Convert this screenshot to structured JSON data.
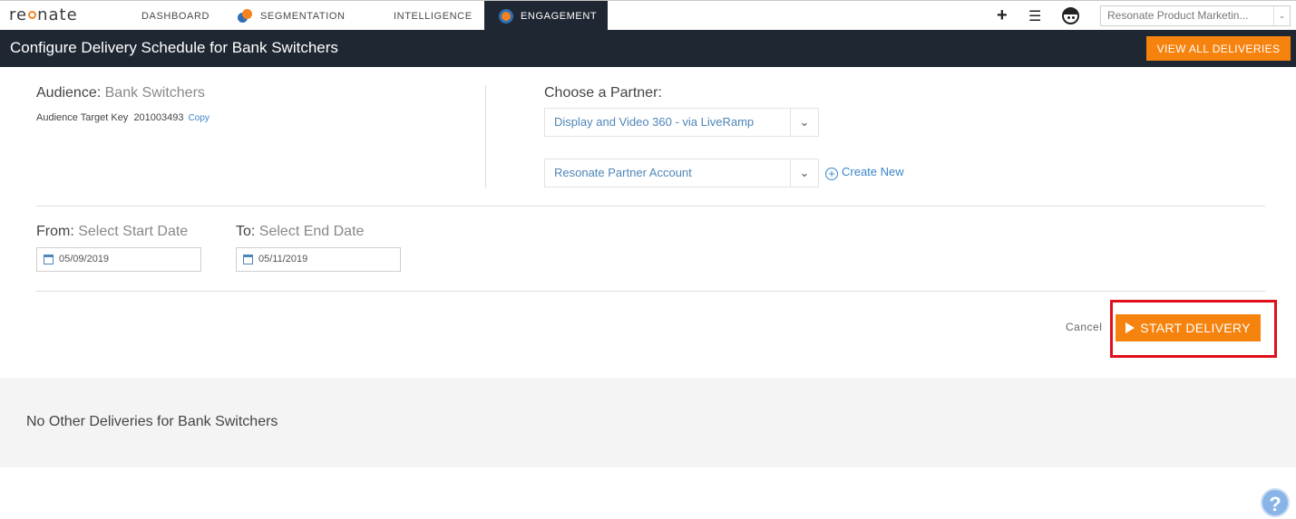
{
  "nav": {
    "logo_prefix": "re",
    "logo_suffix": "nate",
    "dashboard": "DASHBOARD",
    "segmentation": "SEGMENTATION",
    "intelligence": "INTELLIGENCE",
    "engagement": "ENGAGEMENT",
    "active_tab": "ENGAGEMENT",
    "plus_icon": "+",
    "list_icon": "☰",
    "org_select": "Resonate Product Marketin...",
    "org_chevron": "⌄"
  },
  "header": {
    "title": "Configure Delivery Schedule for Bank Switchers",
    "view_all_label": "VIEW ALL DELIVERIES"
  },
  "audience": {
    "label": "Audience:",
    "name": "Bank Switchers",
    "target_key_label": "Audience Target Key",
    "target_key": "201003493",
    "copy_label": "Copy"
  },
  "partner": {
    "label": "Choose a Partner:",
    "selected_partner": "Display and Video 360 - via LiveRamp",
    "selected_account": "Resonate Partner Account",
    "chevron": "⌄",
    "create_new_label": "Create New"
  },
  "dates": {
    "from_label": "From:",
    "from_hint": "Select Start Date",
    "from_value": "05/09/2019",
    "to_label": "To:",
    "to_hint": "Select End Date",
    "to_value": "05/11/2019"
  },
  "actions": {
    "cancel_label": "Cancel",
    "start_label": "START DELIVERY"
  },
  "other": {
    "message": "No Other Deliveries for Bank Switchers"
  },
  "help": {
    "label": "?"
  },
  "colors": {
    "accent": "#f7830f",
    "header_bg": "#1f2733",
    "link": "#3a86c8",
    "highlight": "#e0101a"
  }
}
